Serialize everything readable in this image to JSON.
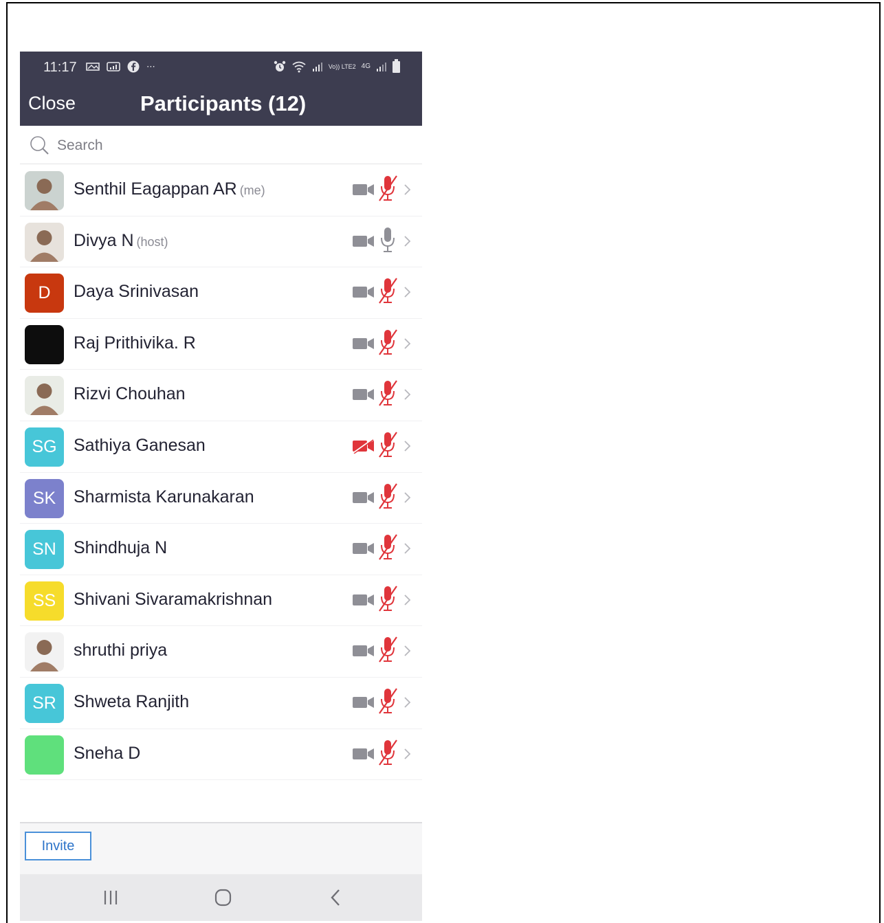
{
  "status_bar": {
    "time": "11:17",
    "left_glyphs": [
      "⋯"
    ],
    "network_label": "4G",
    "volte_label": "Vo)) LTE2"
  },
  "header": {
    "close_label": "Close",
    "title": "Participants (12)",
    "background_color": "#3d3d50"
  },
  "search": {
    "placeholder": "Search"
  },
  "participants": [
    {
      "name": "Senthil Eagappan AR",
      "tag": "(me)",
      "avatar_type": "photo",
      "avatar_color": "#cbd3d0",
      "initials": "",
      "video_muted": false,
      "audio_muted": true
    },
    {
      "name": "Divya N",
      "tag": "(host)",
      "avatar_type": "photo",
      "avatar_color": "#e7e2dc",
      "initials": "",
      "video_muted": false,
      "audio_muted": false
    },
    {
      "name": "Daya Srinivasan",
      "tag": "",
      "avatar_type": "initials",
      "avatar_color": "#c8380f",
      "initials": "D",
      "video_muted": false,
      "audio_muted": true
    },
    {
      "name": "Raj Prithivika. R",
      "tag": "",
      "avatar_type": "solid",
      "avatar_color": "#0d0d0d",
      "initials": "",
      "video_muted": false,
      "audio_muted": true
    },
    {
      "name": "Rizvi Chouhan",
      "tag": "",
      "avatar_type": "photo",
      "avatar_color": "#e9ece6",
      "initials": "",
      "video_muted": false,
      "audio_muted": true
    },
    {
      "name": "Sathiya Ganesan",
      "tag": "",
      "avatar_type": "initials",
      "avatar_color": "#47c6d8",
      "initials": "SG",
      "video_muted": true,
      "audio_muted": true
    },
    {
      "name": "Sharmista Karunakaran",
      "tag": "",
      "avatar_type": "initials",
      "avatar_color": "#7c81cc",
      "initials": "SK",
      "video_muted": false,
      "audio_muted": true
    },
    {
      "name": "Shindhuja N",
      "tag": "",
      "avatar_type": "initials",
      "avatar_color": "#47c6d8",
      "initials": "SN",
      "video_muted": false,
      "audio_muted": true
    },
    {
      "name": "Shivani Sivaramakrishnan",
      "tag": "",
      "avatar_type": "initials",
      "avatar_color": "#f6dc2b",
      "initials": "SS",
      "video_muted": false,
      "audio_muted": true
    },
    {
      "name": "shruthi priya",
      "tag": "",
      "avatar_type": "photo",
      "avatar_color": "#f2f2f2",
      "initials": "",
      "video_muted": false,
      "audio_muted": true
    },
    {
      "name": "Shweta Ranjith",
      "tag": "",
      "avatar_type": "initials",
      "avatar_color": "#47c6d8",
      "initials": "SR",
      "video_muted": false,
      "audio_muted": true
    },
    {
      "name": "Sneha D",
      "tag": "",
      "avatar_type": "solid",
      "avatar_color": "#5fe07c",
      "initials": "",
      "video_muted": false,
      "audio_muted": true
    }
  ],
  "footer": {
    "invite_label": "Invite",
    "accent_color": "#2d74c9"
  },
  "colors": {
    "muted_red": "#e0353b",
    "icon_gray": "#8f8f96"
  }
}
